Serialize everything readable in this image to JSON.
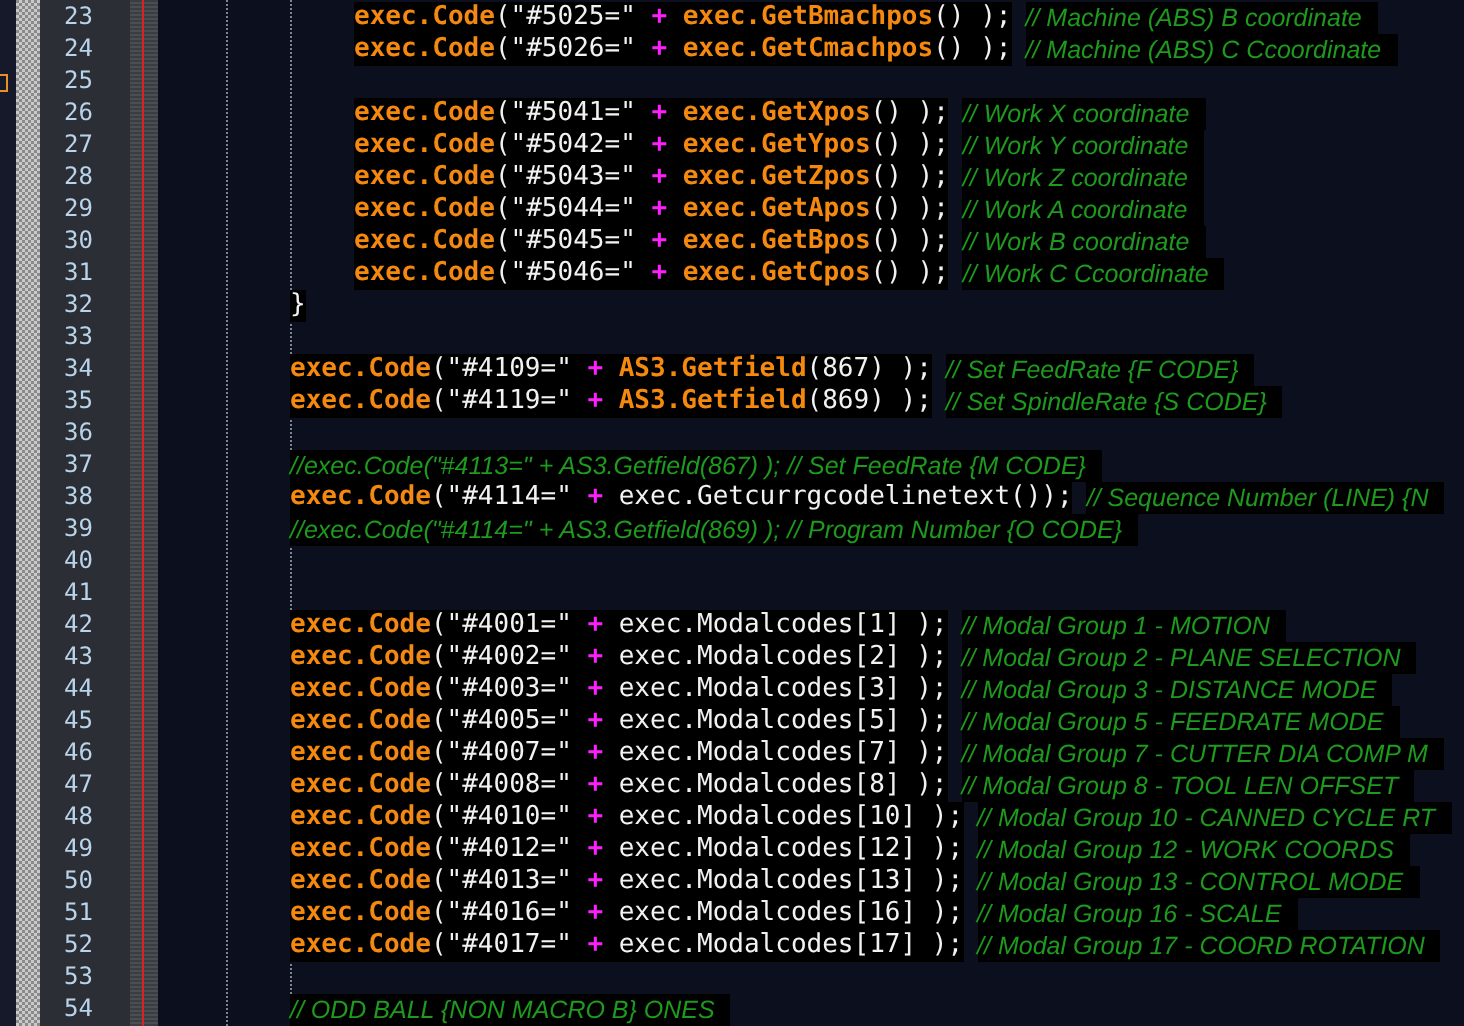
{
  "nested_block": [
    {
      "number": "23",
      "bookmarked": false,
      "code": [
        {
          "kind": "keyword",
          "text": "exec.Code"
        },
        {
          "kind": "plain",
          "text": "(\"#5025=\" "
        },
        {
          "kind": "operator",
          "text": "+"
        },
        {
          "kind": "keyword",
          "text": "exec.GetBmachpos"
        },
        {
          "kind": "plain",
          "text": "() );"
        }
      ],
      "comment": "// Machine (ABS) B coordinate"
    },
    {
      "number": "24",
      "bookmarked": false,
      "code": [
        {
          "kind": "keyword",
          "text": "exec.Code"
        },
        {
          "kind": "plain",
          "text": "(\"#5026=\" "
        },
        {
          "kind": "operator",
          "text": "+"
        },
        {
          "kind": "keyword",
          "text": "exec.GetCmachpos"
        },
        {
          "kind": "plain",
          "text": "() );"
        }
      ],
      "comment": "// Machine (ABS) C Ccoordinate"
    },
    {
      "number": "25",
      "bookmarked": true
    },
    {
      "number": "26",
      "bookmarked": false,
      "code": [
        {
          "kind": "keyword",
          "text": "exec.Code"
        },
        {
          "kind": "plain",
          "text": "(\"#5041=\" "
        },
        {
          "kind": "operator",
          "text": "+"
        },
        {
          "kind": "keyword",
          "text": "exec.GetXpos"
        },
        {
          "kind": "plain",
          "text": "() );"
        }
      ],
      "comment": "// Work X coordinate"
    },
    {
      "number": "27",
      "bookmarked": false,
      "code": [
        {
          "kind": "keyword",
          "text": "exec.Code"
        },
        {
          "kind": "plain",
          "text": "(\"#5042=\" "
        },
        {
          "kind": "operator",
          "text": "+"
        },
        {
          "kind": "keyword",
          "text": "exec.GetYpos"
        },
        {
          "kind": "plain",
          "text": "() );"
        }
      ],
      "comment": "// Work Y coordinate"
    },
    {
      "number": "28",
      "bookmarked": false,
      "code": [
        {
          "kind": "keyword",
          "text": "exec.Code"
        },
        {
          "kind": "plain",
          "text": "(\"#5043=\" "
        },
        {
          "kind": "operator",
          "text": "+"
        },
        {
          "kind": "keyword",
          "text": "exec.GetZpos"
        },
        {
          "kind": "plain",
          "text": "() );"
        }
      ],
      "comment": "// Work Z coordinate"
    },
    {
      "number": "29",
      "bookmarked": false,
      "code": [
        {
          "kind": "keyword",
          "text": "exec.Code"
        },
        {
          "kind": "plain",
          "text": "(\"#5044=\" "
        },
        {
          "kind": "operator",
          "text": "+"
        },
        {
          "kind": "keyword",
          "text": "exec.GetApos"
        },
        {
          "kind": "plain",
          "text": "() );"
        }
      ],
      "comment": "// Work A coordinate"
    },
    {
      "number": "30",
      "bookmarked": false,
      "code": [
        {
          "kind": "keyword",
          "text": "exec.Code"
        },
        {
          "kind": "plain",
          "text": "(\"#5045=\" "
        },
        {
          "kind": "operator",
          "text": "+"
        },
        {
          "kind": "keyword",
          "text": "exec.GetBpos"
        },
        {
          "kind": "plain",
          "text": "() );"
        }
      ],
      "comment": "// Work B coordinate"
    },
    {
      "number": "31",
      "bookmarked": false,
      "code": [
        {
          "kind": "keyword",
          "text": "exec.Code"
        },
        {
          "kind": "plain",
          "text": "(\"#5046=\" "
        },
        {
          "kind": "operator",
          "text": "+"
        },
        {
          "kind": "keyword",
          "text": "exec.GetCpos"
        },
        {
          "kind": "plain",
          "text": "() );"
        }
      ],
      "comment": "// Work C Ccoordinate"
    }
  ],
  "lines": [
    {
      "number": "32",
      "bookmarked": false,
      "code": [
        {
          "kind": "plain",
          "text": "}"
        }
      ]
    },
    {
      "number": "33",
      "bookmarked": false
    },
    {
      "number": "34",
      "bookmarked": false,
      "code": [
        {
          "kind": "keyword",
          "text": "exec.Code"
        },
        {
          "kind": "plain",
          "text": "(\"#4109=\" "
        },
        {
          "kind": "operator",
          "text": "+"
        },
        {
          "kind": "keyword",
          "text": "AS3.Getfield"
        },
        {
          "kind": "plain",
          "text": "(867) );"
        }
      ],
      "comment": "// Set FeedRate {F CODE}"
    },
    {
      "number": "35",
      "bookmarked": false,
      "code": [
        {
          "kind": "keyword",
          "text": "exec.Code"
        },
        {
          "kind": "plain",
          "text": "(\"#4119=\" "
        },
        {
          "kind": "operator",
          "text": "+"
        },
        {
          "kind": "keyword",
          "text": "AS3.Getfield"
        },
        {
          "kind": "plain",
          "text": "(869) );"
        }
      ],
      "comment": "// Set SpindleRate {S CODE}"
    },
    {
      "number": "36",
      "bookmarked": false
    },
    {
      "number": "37",
      "bookmarked": false,
      "comment": "//exec.Code(\"#4113=\" + AS3.Getfield(867) ); // Set FeedRate {M CODE}"
    },
    {
      "number": "38",
      "bookmarked": false,
      "code": [
        {
          "kind": "keyword",
          "text": "exec.Code"
        },
        {
          "kind": "plain",
          "text": "(\"#4114=\" "
        },
        {
          "kind": "operator",
          "text": "+"
        },
        {
          "kind": "plain",
          "text": "exec.Getcurrgcodelinetext());"
        }
      ],
      "comment": "// Sequence Number (LINE) {N"
    },
    {
      "number": "39",
      "bookmarked": false,
      "comment": "//exec.Code(\"#4114=\" + AS3.Getfield(869) ); // Program Number {O CODE}"
    },
    {
      "number": "40",
      "bookmarked": false
    },
    {
      "number": "41",
      "bookmarked": false
    },
    {
      "number": "42",
      "bookmarked": false,
      "code": [
        {
          "kind": "keyword",
          "text": "exec.Code"
        },
        {
          "kind": "plain",
          "text": "(\"#4001=\" "
        },
        {
          "kind": "operator",
          "text": "+"
        },
        {
          "kind": "plain",
          "text": "exec.Modalcodes[1] );"
        }
      ],
      "comment": "// Modal Group 1 - MOTION"
    },
    {
      "number": "43",
      "bookmarked": false,
      "code": [
        {
          "kind": "keyword",
          "text": "exec.Code"
        },
        {
          "kind": "plain",
          "text": "(\"#4002=\" "
        },
        {
          "kind": "operator",
          "text": "+"
        },
        {
          "kind": "plain",
          "text": "exec.Modalcodes[2] );"
        }
      ],
      "comment": "// Modal Group 2 - PLANE SELECTION"
    },
    {
      "number": "44",
      "bookmarked": false,
      "code": [
        {
          "kind": "keyword",
          "text": "exec.Code"
        },
        {
          "kind": "plain",
          "text": "(\"#4003=\" "
        },
        {
          "kind": "operator",
          "text": "+"
        },
        {
          "kind": "plain",
          "text": "exec.Modalcodes[3] );"
        }
      ],
      "comment": "// Modal Group 3 - DISTANCE MODE"
    },
    {
      "number": "45",
      "bookmarked": false,
      "code": [
        {
          "kind": "keyword",
          "text": "exec.Code"
        },
        {
          "kind": "plain",
          "text": "(\"#4005=\" "
        },
        {
          "kind": "operator",
          "text": "+"
        },
        {
          "kind": "plain",
          "text": "exec.Modalcodes[5] );"
        }
      ],
      "comment": "// Modal Group 5 - FEEDRATE MODE"
    },
    {
      "number": "46",
      "bookmarked": false,
      "code": [
        {
          "kind": "keyword",
          "text": "exec.Code"
        },
        {
          "kind": "plain",
          "text": "(\"#4007=\" "
        },
        {
          "kind": "operator",
          "text": "+"
        },
        {
          "kind": "plain",
          "text": "exec.Modalcodes[7] );"
        }
      ],
      "comment": "// Modal Group 7 - CUTTER DIA COMP M"
    },
    {
      "number": "47",
      "bookmarked": false,
      "code": [
        {
          "kind": "keyword",
          "text": "exec.Code"
        },
        {
          "kind": "plain",
          "text": "(\"#4008=\" "
        },
        {
          "kind": "operator",
          "text": "+"
        },
        {
          "kind": "plain",
          "text": "exec.Modalcodes[8] );"
        }
      ],
      "comment": "// Modal Group 8 - TOOL LEN OFFSET"
    },
    {
      "number": "48",
      "bookmarked": false,
      "code": [
        {
          "kind": "keyword",
          "text": "exec.Code"
        },
        {
          "kind": "plain",
          "text": "(\"#4010=\" "
        },
        {
          "kind": "operator",
          "text": "+"
        },
        {
          "kind": "plain",
          "text": "exec.Modalcodes[10] );"
        }
      ],
      "comment": "// Modal Group 10 - CANNED CYCLE RT"
    },
    {
      "number": "49",
      "bookmarked": false,
      "code": [
        {
          "kind": "keyword",
          "text": "exec.Code"
        },
        {
          "kind": "plain",
          "text": "(\"#4012=\" "
        },
        {
          "kind": "operator",
          "text": "+"
        },
        {
          "kind": "plain",
          "text": "exec.Modalcodes[12] );"
        }
      ],
      "comment": "// Modal Group 12 - WORK COORDS"
    },
    {
      "number": "50",
      "bookmarked": false,
      "code": [
        {
          "kind": "keyword",
          "text": "exec.Code"
        },
        {
          "kind": "plain",
          "text": "(\"#4013=\" "
        },
        {
          "kind": "operator",
          "text": "+"
        },
        {
          "kind": "plain",
          "text": "exec.Modalcodes[13] );"
        }
      ],
      "comment": "// Modal Group 13 - CONTROL MODE"
    },
    {
      "number": "51",
      "bookmarked": false,
      "code": [
        {
          "kind": "keyword",
          "text": "exec.Code"
        },
        {
          "kind": "plain",
          "text": "(\"#4016=\" "
        },
        {
          "kind": "operator",
          "text": "+"
        },
        {
          "kind": "plain",
          "text": "exec.Modalcodes[16] );"
        }
      ],
      "comment": "// Modal Group 16 - SCALE"
    },
    {
      "number": "52",
      "bookmarked": false,
      "code": [
        {
          "kind": "keyword",
          "text": "exec.Code"
        },
        {
          "kind": "plain",
          "text": "(\"#4017=\" "
        },
        {
          "kind": "operator",
          "text": "+"
        },
        {
          "kind": "plain",
          "text": "exec.Modalcodes[17] );"
        }
      ],
      "comment": "// Modal Group 17 - COORD ROTATION"
    },
    {
      "number": "53",
      "bookmarked": false
    },
    {
      "number": "54",
      "bookmarked": false,
      "comment": "// ODD BALL {NON MACRO B} ONES"
    }
  ]
}
